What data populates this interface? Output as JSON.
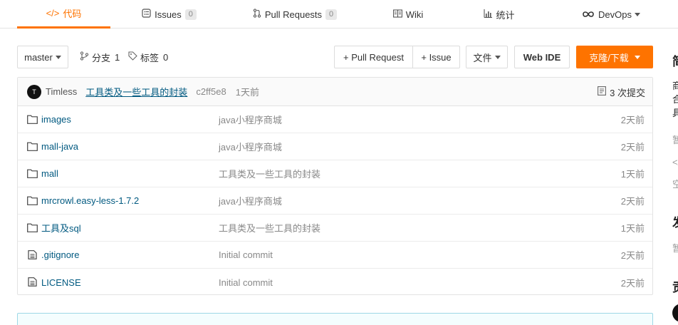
{
  "nav": {
    "code": "代码",
    "issues": "Issues",
    "issues_count": "0",
    "pull_requests": "Pull Requests",
    "pull_requests_count": "0",
    "wiki": "Wiki",
    "stats": "统计",
    "devops": "DevOps"
  },
  "toolbar": {
    "branch": "master",
    "branches_label": "分支",
    "branches_count": "1",
    "tags_label": "标签",
    "tags_count": "0",
    "pull_request": "+ Pull Request",
    "issue": "+ Issue",
    "file": "文件",
    "web_ide": "Web IDE",
    "clone": "克隆/下载"
  },
  "commit": {
    "avatar_initial": "T",
    "author": "Timless",
    "message": "工具类及一些工具的封装",
    "sha": "c2ff5e8",
    "time": "1天前",
    "count_label": "3 次提交"
  },
  "files": [
    {
      "name": "images",
      "type": "folder",
      "message": "java小程序商城",
      "date": "2天前"
    },
    {
      "name": "mall-java",
      "type": "folder",
      "message": "java小程序商城",
      "date": "2天前"
    },
    {
      "name": "mall",
      "type": "folder",
      "message": "工具类及一些工具的封装",
      "date": "1天前"
    },
    {
      "name": "mrcrowl.easy-less-1.7.2",
      "type": "folder",
      "message": "java小程序商城",
      "date": "2天前"
    },
    {
      "name": "工具及sql",
      "type": "folder",
      "message": "工具类及一些工具的封装",
      "date": "1天前"
    },
    {
      "name": ".gitignore",
      "type": "file",
      "message": "Initial commit",
      "date": "2天前"
    },
    {
      "name": "LICENSE",
      "type": "file",
      "message": "Initial commit",
      "date": "2天前"
    }
  ],
  "sidebar": {
    "s1": "简",
    "s2": "商",
    "s3": "合",
    "s4": "具",
    "s5": "暂",
    "s6": "</",
    "s7": "空",
    "s8": "发",
    "s9": "暂",
    "s10": "贡"
  }
}
